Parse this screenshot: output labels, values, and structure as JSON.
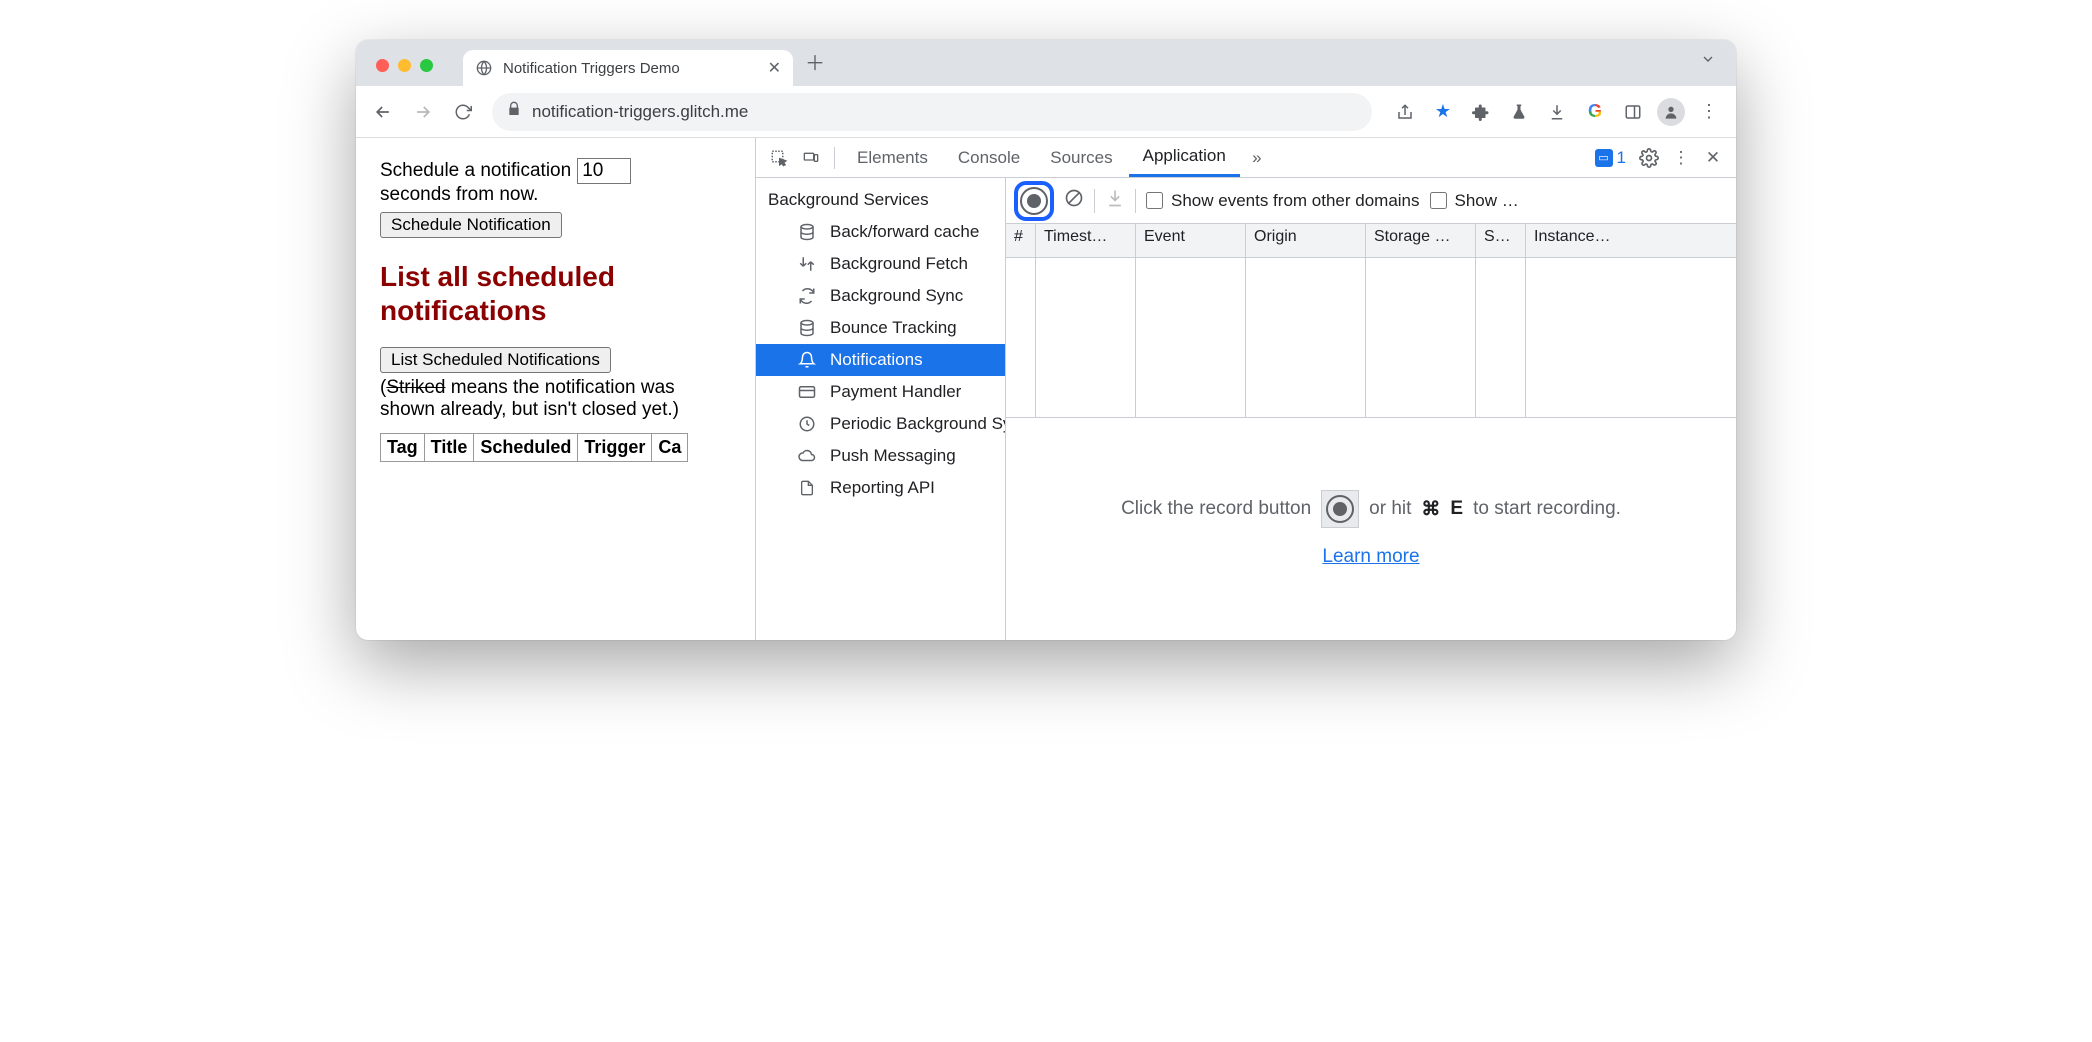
{
  "tab": {
    "title": "Notification Triggers Demo"
  },
  "address": {
    "url": "notification-triggers.glitch.me"
  },
  "page": {
    "schedule_prefix": "Schedule a notification",
    "seconds_value": "10",
    "schedule_suffix": "seconds from now.",
    "schedule_btn": "Schedule Notification",
    "heading": "List all scheduled notifications",
    "list_btn": "List Scheduled Notifications",
    "note_open": "(",
    "note_strike": "Striked",
    "note_rest": " means the notification was shown already, but isn't closed yet.)",
    "cols": [
      "Tag",
      "Title",
      "Scheduled",
      "Trigger",
      "Ca"
    ]
  },
  "devtools": {
    "tabs": {
      "elements": "Elements",
      "console": "Console",
      "sources": "Sources",
      "application": "Application"
    },
    "issues_count": "1",
    "sidebar": {
      "category": "Background Services",
      "items": [
        "Back/forward cache",
        "Background Fetch",
        "Background Sync",
        "Bounce Tracking",
        "Notifications",
        "Payment Handler",
        "Periodic Background Sync",
        "Push Messaging",
        "Reporting API"
      ]
    },
    "toolbar": {
      "show_other": "Show events from other domains",
      "show_trunc": "Show …"
    },
    "columns": [
      "#",
      "Timest…",
      "Event",
      "Origin",
      "Storage …",
      "S…",
      "Instance…"
    ],
    "empty": {
      "text1": "Click the record button",
      "text2": "or hit",
      "shortcut_sym": "⌘",
      "shortcut_key": "E",
      "text3": "to start recording.",
      "learn": "Learn more"
    }
  }
}
